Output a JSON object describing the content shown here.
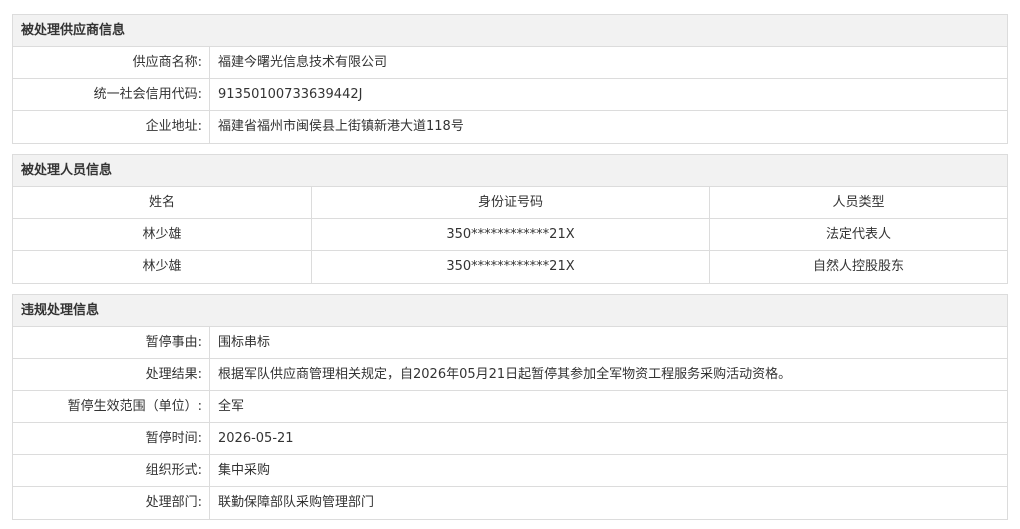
{
  "supplier": {
    "title": "被处理供应商信息",
    "rows": [
      {
        "label": "供应商名称:",
        "value": "福建今曙光信息技术有限公司"
      },
      {
        "label": "统一社会信用代码:",
        "value": "91350100733639442J"
      },
      {
        "label": "企业地址:",
        "value": "福建省福州市闽侯县上街镇新港大道118号"
      }
    ]
  },
  "personnel": {
    "title": "被处理人员信息",
    "headers": [
      "姓名",
      "身份证号码",
      "人员类型"
    ],
    "rows": [
      [
        "林少雄",
        "350************21X",
        "法定代表人"
      ],
      [
        "林少雄",
        "350************21X",
        "自然人控股股东"
      ]
    ]
  },
  "violation": {
    "title": "违规处理信息",
    "rows": [
      {
        "label": "暂停事由:",
        "value": "围标串标"
      },
      {
        "label": "处理结果:",
        "value": "根据军队供应商管理相关规定，自2026年05月21日起暂停其参加全军物资工程服务采购活动资格。"
      },
      {
        "label": "暂停生效范围（单位）:",
        "value": "全军"
      },
      {
        "label": "暂停时间:",
        "value": "2026-05-21"
      },
      {
        "label": "组织形式:",
        "value": "集中采购"
      },
      {
        "label": "处理部门:",
        "value": "联勤保障部队采购管理部门"
      }
    ]
  }
}
